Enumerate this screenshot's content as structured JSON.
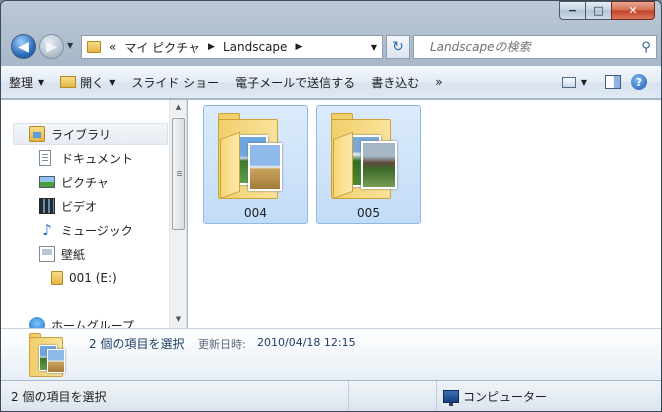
{
  "window": {
    "caption_buttons": {
      "minimize": "−",
      "maximize": "□",
      "close": "✕"
    }
  },
  "nav": {
    "back_glyph": "◀",
    "forward_glyph": "▶",
    "breadcrumb": [
      "«",
      "マイ ピクチャ",
      "Landscape"
    ],
    "refresh_glyph": "↻",
    "search_placeholder": "Landscapeの検索"
  },
  "toolbar": {
    "organize": "整理",
    "open": "開く",
    "slideshow": "スライド ショー",
    "email": "電子メールで送信する",
    "burn": "書き込む",
    "more": "»",
    "help": "?"
  },
  "sidebar": {
    "items": [
      {
        "label": "ライブラリ",
        "icon": "library-icon"
      },
      {
        "label": "ドキュメント",
        "icon": "document-icon"
      },
      {
        "label": "ピクチャ",
        "icon": "picture-icon"
      },
      {
        "label": "ビデオ",
        "icon": "video-icon"
      },
      {
        "label": "ミュージック",
        "icon": "music-icon"
      },
      {
        "label": "壁紙",
        "icon": "wallpaper-icon"
      },
      {
        "label": "001 (E:)",
        "icon": "drive-icon"
      },
      {
        "label": "ホームグループ",
        "icon": "homegroup-icon"
      }
    ]
  },
  "content": {
    "folders": [
      {
        "name": "004",
        "selected": true
      },
      {
        "name": "005",
        "selected": true
      }
    ]
  },
  "details": {
    "count": "2 個の項目を選択",
    "date_label": "更新日時:",
    "date_value": "2010/04/18 12:15"
  },
  "status": {
    "left": "2 個の項目を選択",
    "right": "コンピューター"
  },
  "colors": {
    "selection_fill": "#cfe3fa",
    "selection_border": "#8fb7e3",
    "toolbar_bg": "#e3ebf4"
  }
}
